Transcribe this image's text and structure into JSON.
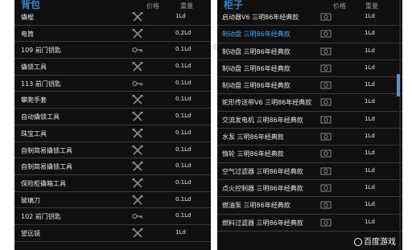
{
  "backpack": {
    "title": "背包",
    "col_price": "价格",
    "col_weight": "重量",
    "items": [
      {
        "name": "撬棍",
        "icon": "tools-icon",
        "weight": "1Ld"
      },
      {
        "name": "电筒",
        "icon": "tools-icon",
        "weight": "0.2Ld"
      },
      {
        "name": "109 前门钥匙",
        "icon": "key-icon",
        "weight": "0.1Ld"
      },
      {
        "name": "撬锁工具",
        "icon": "tools-icon",
        "weight": "0.1Ld"
      },
      {
        "name": "113 前门钥匙",
        "icon": "key-icon",
        "weight": "0.1Ld"
      },
      {
        "name": "攀爬手套",
        "icon": "tools-icon",
        "weight": "0.1Ld"
      },
      {
        "name": "自动撬锁工具",
        "icon": "tools-icon",
        "weight": "0.1Ld"
      },
      {
        "name": "珠宝工具",
        "icon": "tools-icon",
        "weight": "0.1Ld"
      },
      {
        "name": "自制简易撬锁工具",
        "icon": "tools-icon",
        "weight": "0.1Ld"
      },
      {
        "name": "自制简易撬锁工具",
        "icon": "tools-icon",
        "weight": "0.1Ld"
      },
      {
        "name": "保险柜撬箱工具",
        "icon": "tools-icon",
        "weight": "0.1Ld"
      },
      {
        "name": "玻璃刀",
        "icon": "tools-icon",
        "weight": "0.1Ld"
      },
      {
        "name": "102 前门钥匙",
        "icon": "key-icon",
        "weight": "0.1Ld"
      },
      {
        "name": "望远镜",
        "icon": "tools-icon",
        "weight": "1Ld"
      }
    ]
  },
  "cabinet": {
    "title": "柜子",
    "col_price": "价格",
    "col_weight": "重量",
    "items": [
      {
        "name": "启动器V6 三明86年经典款",
        "icon": "part-icon",
        "weight": "1Ld"
      },
      {
        "name": "制动盘 三明86年经典款",
        "icon": "part-icon",
        "weight": "1Ld",
        "selected": true
      },
      {
        "name": "制动盘 三明86年经典款",
        "icon": "part-icon",
        "weight": "1Ld"
      },
      {
        "name": "制动盘 三明86年经典款",
        "icon": "part-icon",
        "weight": "1Ld"
      },
      {
        "name": "制动盘 三明86年经典款",
        "icon": "part-icon",
        "weight": "1Ld"
      },
      {
        "name": "蛇形传送带V6 三明86年经典款",
        "icon": "part-icon",
        "weight": "1Ld"
      },
      {
        "name": "交流发电机 三明86年经典款",
        "icon": "part-icon",
        "weight": "1Ld"
      },
      {
        "name": "水泵 三明86年经典款",
        "icon": "part-icon",
        "weight": "1Ld"
      },
      {
        "name": "惰轮 三明86年经典款",
        "icon": "part-icon",
        "weight": "1Ld"
      },
      {
        "name": "空气过滤器 三明86年经典款",
        "icon": "part-icon",
        "weight": "1Ld"
      },
      {
        "name": "点火控制器 三明86年经典款",
        "icon": "part-icon",
        "weight": "1Ld"
      },
      {
        "name": "燃油泵 三明86年经典款",
        "icon": "part-icon",
        "weight": "1Ld"
      },
      {
        "name": "燃料过滤器 三明86年经典款",
        "icon": "part-icon",
        "weight": "1Ld"
      }
    ]
  },
  "watermark": {
    "text": "百度游戏",
    "icon": "baidu-paw-icon"
  }
}
